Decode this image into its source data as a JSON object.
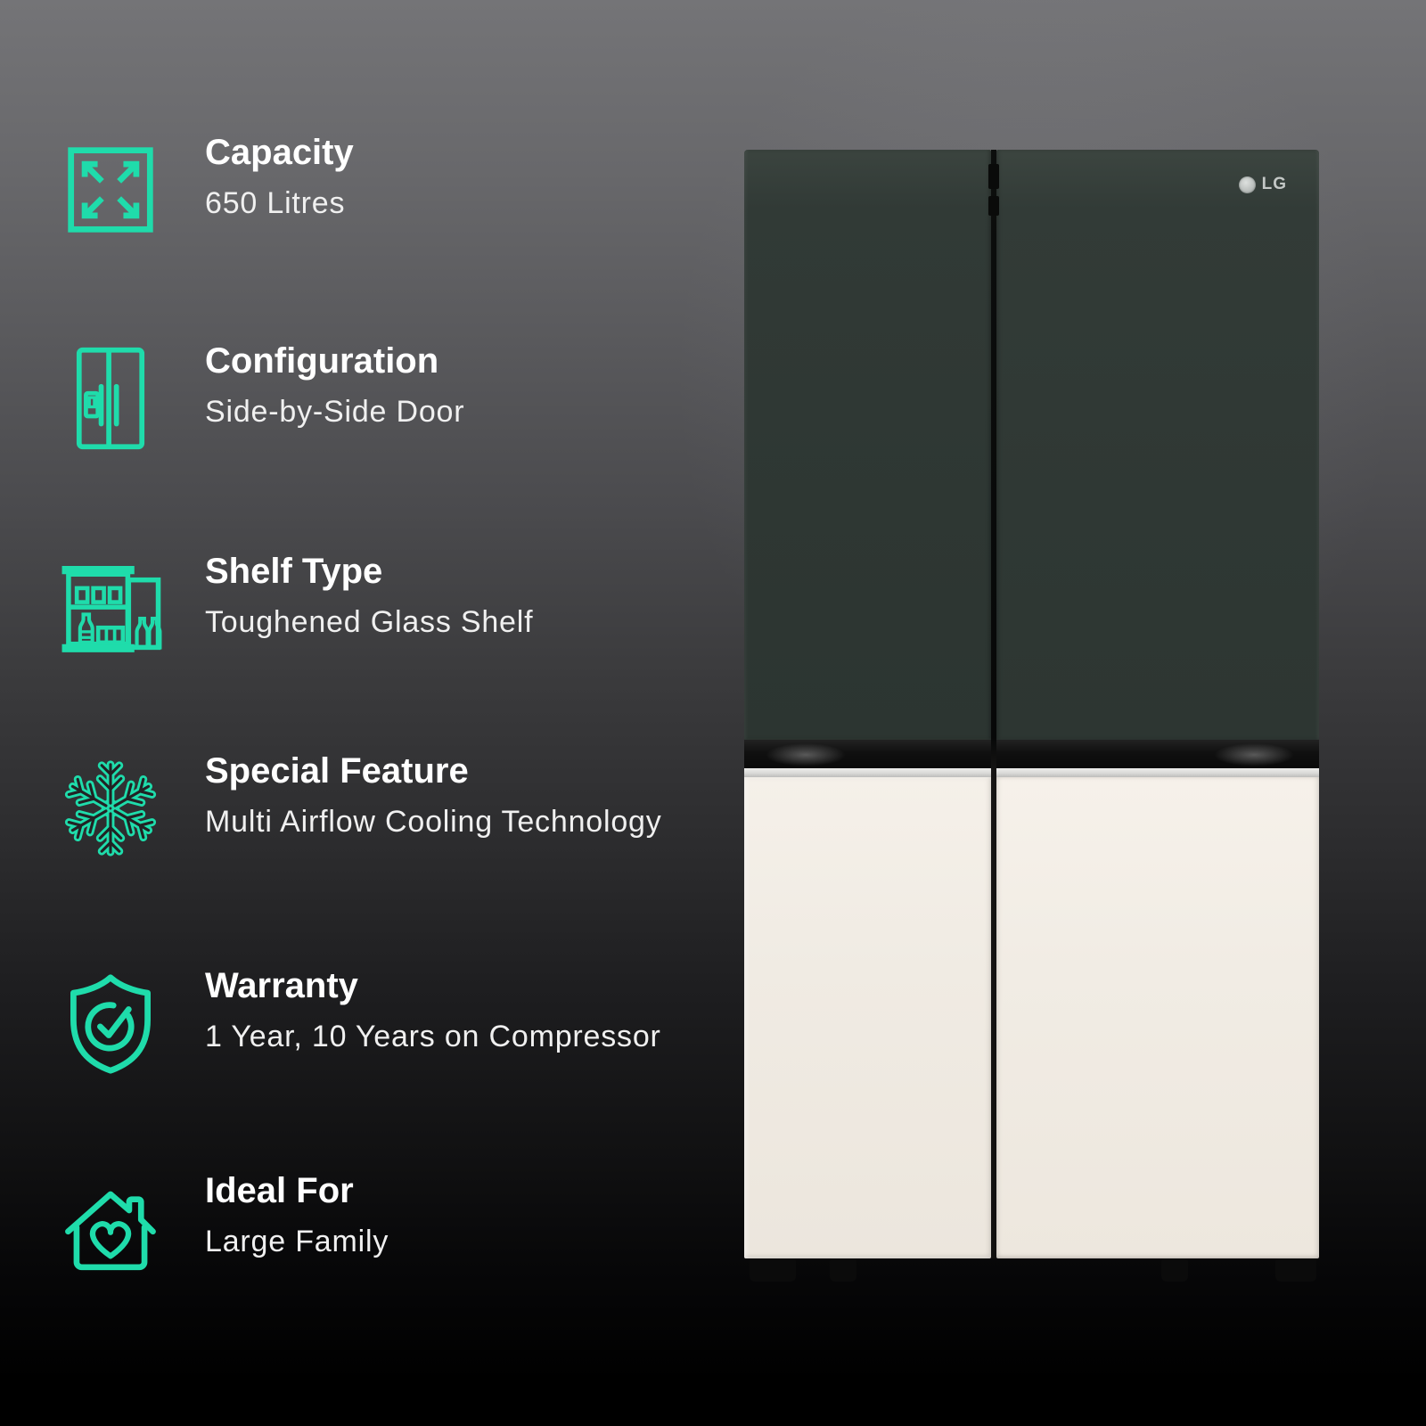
{
  "accent_color": "#1fdcab",
  "features": [
    {
      "icon": "capacity-expand-icon",
      "title": "Capacity",
      "value": "650 Litres"
    },
    {
      "icon": "side-by-side-fridge-icon",
      "title": "Configuration",
      "value": "Side-by-Side Door"
    },
    {
      "icon": "shelf-bottles-icon",
      "title": "Shelf Type",
      "value": "Toughened Glass Shelf"
    },
    {
      "icon": "snowflake-icon",
      "title": "Special Feature",
      "value": "Multi Airflow Cooling Technology"
    },
    {
      "icon": "shield-check-icon",
      "title": "Warranty",
      "value": "1 Year, 10 Years on Compressor"
    },
    {
      "icon": "house-heart-icon",
      "title": "Ideal For",
      "value": "Large Family"
    }
  ],
  "product": {
    "brand": "LG",
    "upper_door_color": "#2f3834",
    "lower_door_color": "#f0ebe3"
  }
}
